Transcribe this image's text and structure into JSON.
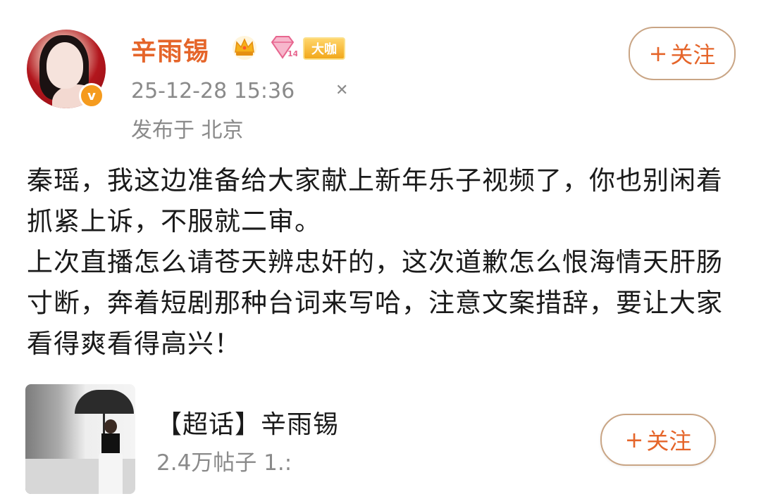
{
  "post": {
    "username": "辛雨锡",
    "badge_label": "大咖",
    "timestamp": "25-12-28 15:36",
    "location": "发布于 北京",
    "follow_label": "关注",
    "paragraph_1": "秦瑶，我这边准备给大家献上新年乐子视频了，你也别闲着抓紧上诉，不服就二审。",
    "paragraph_2": "上次直播怎么请苍天辨忠奸的，这次道歉怎么恨海情天肝肠寸断，奔着短剧那种台词来写哈，注意文案措辞，要让大家看得爽看得高兴！"
  },
  "supertopic": {
    "title": "【超话】辛雨锡",
    "stats": "2.4万帖子 1.:",
    "follow_label": "关注"
  },
  "icons": {
    "plus": "+",
    "verified": "v",
    "close": "✕"
  },
  "colors": {
    "username": "#e5652a",
    "follow_border": "#c9a585",
    "meta_text": "#8a8a8a",
    "verified_badge": "#f59b1e"
  }
}
